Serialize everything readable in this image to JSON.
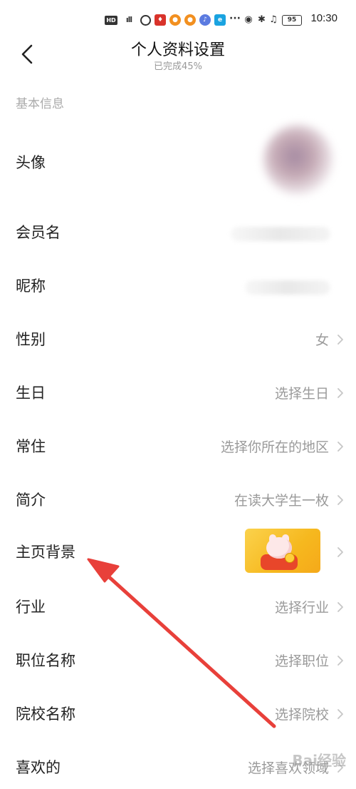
{
  "status_bar": {
    "time": "10:30",
    "battery": "95",
    "hd_label": "HD",
    "signal_label": "4G"
  },
  "header": {
    "back_icon": "chevron-left-icon",
    "title": "个人资料设置",
    "subtitle": "已完成45%",
    "completion_percent": 45
  },
  "section": {
    "title": "基本信息"
  },
  "rows": [
    {
      "label": "头像",
      "value": "",
      "kind": "avatar"
    },
    {
      "label": "会员名",
      "value": "",
      "kind": "blurred"
    },
    {
      "label": "昵称",
      "value": "",
      "kind": "blurred"
    },
    {
      "label": "性别",
      "value": "女",
      "kind": "text"
    },
    {
      "label": "生日",
      "value": "选择生日",
      "kind": "text"
    },
    {
      "label": "常住",
      "value": "选择你所在的地区",
      "kind": "text"
    },
    {
      "label": "简介",
      "value": "在读大学生一枚",
      "kind": "text"
    },
    {
      "label": "主页背景",
      "value": "",
      "kind": "image"
    },
    {
      "label": "行业",
      "value": "选择行业",
      "kind": "text"
    },
    {
      "label": "职位名称",
      "value": "选择职位",
      "kind": "text"
    },
    {
      "label": "院校名称",
      "value": "选择院校",
      "kind": "text"
    },
    {
      "label": "喜欢的",
      "value": "选择喜欢领域",
      "kind": "text"
    }
  ],
  "annotation": {
    "color": "#e8403a"
  },
  "watermark": "Bai经验"
}
